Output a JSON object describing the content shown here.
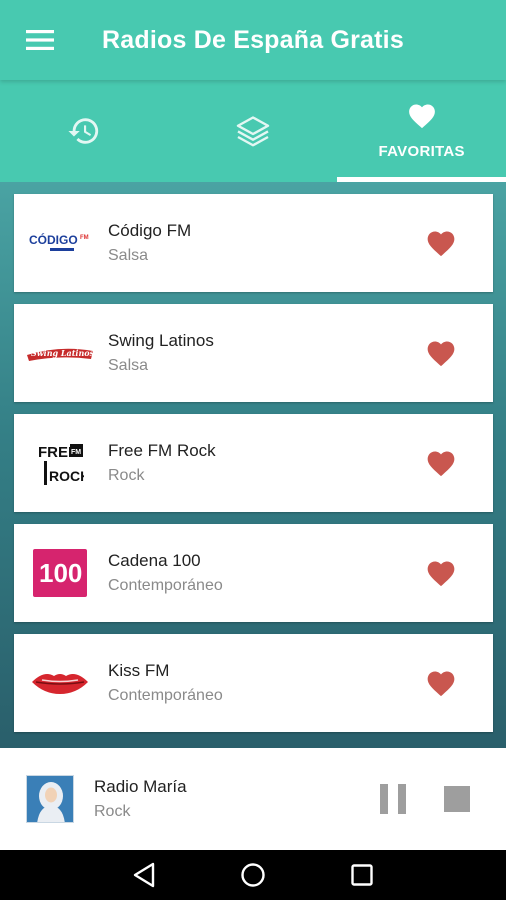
{
  "app": {
    "title": "Radios De España Gratis"
  },
  "tabs": [
    {
      "icon": "history-icon",
      "label": ""
    },
    {
      "icon": "layers-icon",
      "label": ""
    },
    {
      "icon": "heart-icon",
      "label": "FAVORITAS",
      "active": true
    }
  ],
  "stations": [
    {
      "name": "Código FM",
      "genre": "Salsa",
      "logo": "codigo-fm-logo"
    },
    {
      "name": "Swing Latinos",
      "genre": "Salsa",
      "logo": "swing-latinos-logo"
    },
    {
      "name": "Free FM Rock",
      "genre": "Rock",
      "logo": "free-fm-rock-logo"
    },
    {
      "name": "Cadena 100",
      "genre": "Contemporáneo",
      "logo": "cadena-100-logo"
    },
    {
      "name": "Kiss FM",
      "genre": "Contemporáneo",
      "logo": "kiss-fm-logo"
    }
  ],
  "player": {
    "name": "Radio María",
    "genre": "Rock",
    "state": "playing"
  },
  "logos": {
    "codigo_text": "CÓDIGO",
    "codigo_fm": "FM",
    "swing_text": "Swing Latinos",
    "free_text": "FREE",
    "free_fm": "FM",
    "rock_text": "ROCK",
    "cadena_text": "100"
  },
  "colors": {
    "accent": "#48c9b0",
    "heart": "#c9574f",
    "indicator": "#ffffff"
  }
}
